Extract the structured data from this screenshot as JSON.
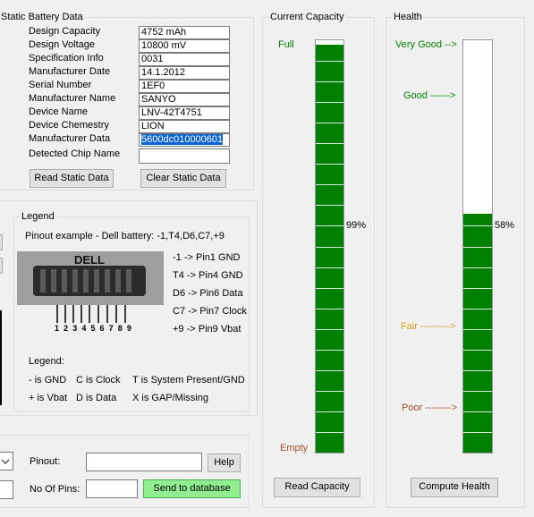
{
  "static_battery": {
    "title": "Static Battery Data",
    "rows": [
      {
        "label": "Design Capacity",
        "value": "4752 mAh"
      },
      {
        "label": "Design Voltage",
        "value": "10800 mV"
      },
      {
        "label": "Specification Info",
        "value": "0031"
      },
      {
        "label": "Manufacturer Date",
        "value": "14.1.2012"
      },
      {
        "label": "Serial Number",
        "value": "1EF0"
      },
      {
        "label": "Manufacturer Name",
        "value": "SANYO"
      },
      {
        "label": "Device Name",
        "value": "LNV-42T4751"
      },
      {
        "label": "Device Chemestry",
        "value": "LION"
      },
      {
        "label": "Manufacturer Data",
        "value": "5600dc010000601"
      },
      {
        "label": "Detected Chip Name",
        "value": ""
      }
    ],
    "read_button": "Read Static Data",
    "clear_button": "Clear Static Data"
  },
  "legend": {
    "title": "Legend",
    "pinout_example": "Pinout example - Dell battery:  -1,T4,D6,C7,+9",
    "connector_label": "DELL",
    "pin_numbers": "1 2 3 4 5 6 7 8 9",
    "pin_map": [
      "-1 -> Pin1 GND",
      "T4 -> Pin4 GND",
      "D6 -> Pin6 Data",
      "C7 -> Pin7 Clock",
      "+9 -> Pin9 Vbat"
    ],
    "legend_label": "Legend:",
    "keys_row1": [
      "- is GND",
      "C is Clock",
      "T is System Present/GND"
    ],
    "keys_row2": [
      "+ is Vbat",
      "D is Data",
      "X is GAP/Missing"
    ]
  },
  "bottom": {
    "pinout_label": "Pinout:",
    "pinout_value": "",
    "help_button": "Help",
    "no_of_pins_label": "No Of Pins:",
    "no_of_pins_value": "",
    "send_button": "Send to database"
  },
  "current_capacity": {
    "title": "Current Capacity",
    "full_label": "Full",
    "empty_label": "Empty",
    "percent_text": "99%",
    "percent": 99,
    "read_button": "Read Capacity",
    "full_color": "#008000",
    "empty_color": "#a0522d",
    "bar_color": "#008000"
  },
  "health": {
    "title": "Health",
    "very_good": "Very Good -->",
    "good": "Good ------>",
    "fair": "Fair --------->",
    "poor": "Poor -------->",
    "percent_text": "58%",
    "percent": 58,
    "compute_button": "Compute Health",
    "good_color": "#008000",
    "fair_color": "#d4a017",
    "poor_color": "#a0522d",
    "bar_color": "#008000"
  }
}
